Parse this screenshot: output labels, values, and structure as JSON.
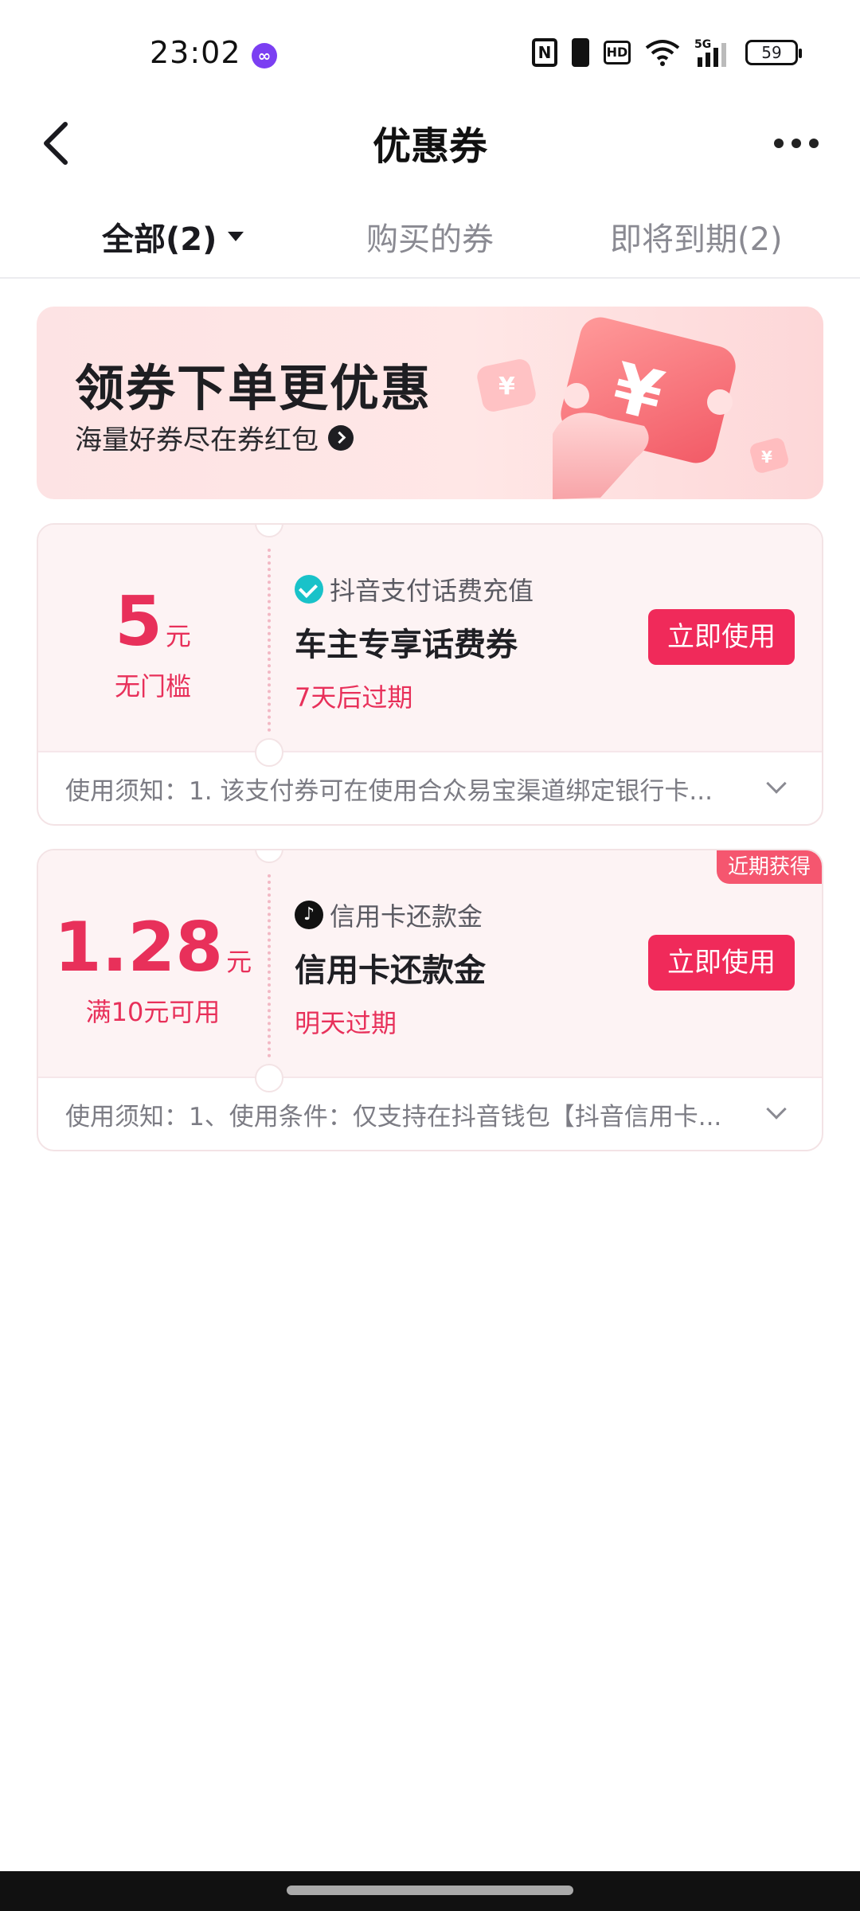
{
  "status_bar": {
    "time": "23:02",
    "network": "5G",
    "battery": "59"
  },
  "header": {
    "title": "优惠券"
  },
  "tabs": [
    {
      "label": "全部(2)",
      "active": true
    },
    {
      "label": "购买的券",
      "active": false
    },
    {
      "label": "即将到期(2)",
      "active": false
    }
  ],
  "banner": {
    "title": "领券下单更优惠",
    "subtitle": "海量好券尽在券红包"
  },
  "coupons": [
    {
      "amount": "5",
      "unit": "元",
      "condition": "无门槛",
      "source": "抖音支付话费充值",
      "name": "车主专享话费券",
      "expiry": "7天后过期",
      "button": "立即使用",
      "notice": "使用须知：1. 该支付券可在使用合众易宝渠道绑定银行卡..."
    },
    {
      "amount": "1.28",
      "unit": "元",
      "condition": "满10元可用",
      "source": "信用卡还款金",
      "name": "信用卡还款金",
      "expiry": "明天过期",
      "button": "立即使用",
      "badge": "近期获得",
      "notice": "使用须知：1、使用条件：仅支持在抖音钱包【抖音信用卡..."
    }
  ],
  "colors": {
    "accent": "#f02a5a",
    "price": "#e8305a",
    "banner_bg": "#fde3e4",
    "card_bg": "#fdf3f4"
  }
}
